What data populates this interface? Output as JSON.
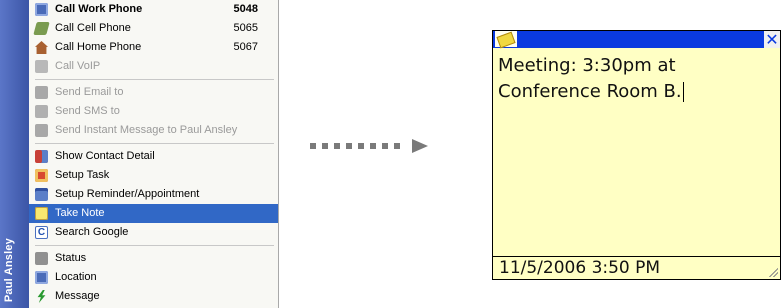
{
  "menu": {
    "contact_name": "Paul Ansley",
    "items": [
      {
        "label": "Call Work Phone",
        "extension": "5048",
        "icon": "work-phone-icon",
        "bold": true
      },
      {
        "label": "Call Cell Phone",
        "extension": "5065",
        "icon": "cell-phone-icon"
      },
      {
        "label": "Call Home Phone",
        "extension": "5067",
        "icon": "home-icon"
      },
      {
        "label": "Call VoIP",
        "extension": "",
        "icon": "voip-icon",
        "disabled": true
      },
      {
        "label": "Send Email to",
        "extension": "",
        "icon": "email-icon",
        "disabled": true
      },
      {
        "label": "Send SMS to",
        "extension": "",
        "icon": "sms-icon",
        "disabled": true
      },
      {
        "label": "Send Instant Message to Paul Ansley",
        "extension": "",
        "icon": "instant-message-icon",
        "disabled": true
      },
      {
        "label": "Show Contact Detail",
        "icon": "contact-card-icon"
      },
      {
        "label": "Setup Task",
        "icon": "task-icon"
      },
      {
        "label": "Setup Reminder/Appointment",
        "icon": "calendar-icon"
      },
      {
        "label": "Take Note",
        "icon": "note-icon",
        "selected": true
      },
      {
        "label": "Search Google",
        "icon": "google-icon",
        "icon_glyph": "C"
      },
      {
        "label": "Status",
        "icon": "status-icon"
      },
      {
        "label": "Location",
        "icon": "location-icon"
      },
      {
        "label": "Message",
        "icon": "message-icon"
      }
    ]
  },
  "note": {
    "text": "Meeting: 3:30pm at\nConference Room B.",
    "timestamp": "11/5/2006 3:50 PM",
    "close_glyph": "✕"
  },
  "colors": {
    "selection": "#3168c6",
    "side_band": "#4a64b8",
    "note_background": "#ffffc4",
    "note_titlebar": "#0a3ae0",
    "disabled_text": "#9a9a9a"
  }
}
